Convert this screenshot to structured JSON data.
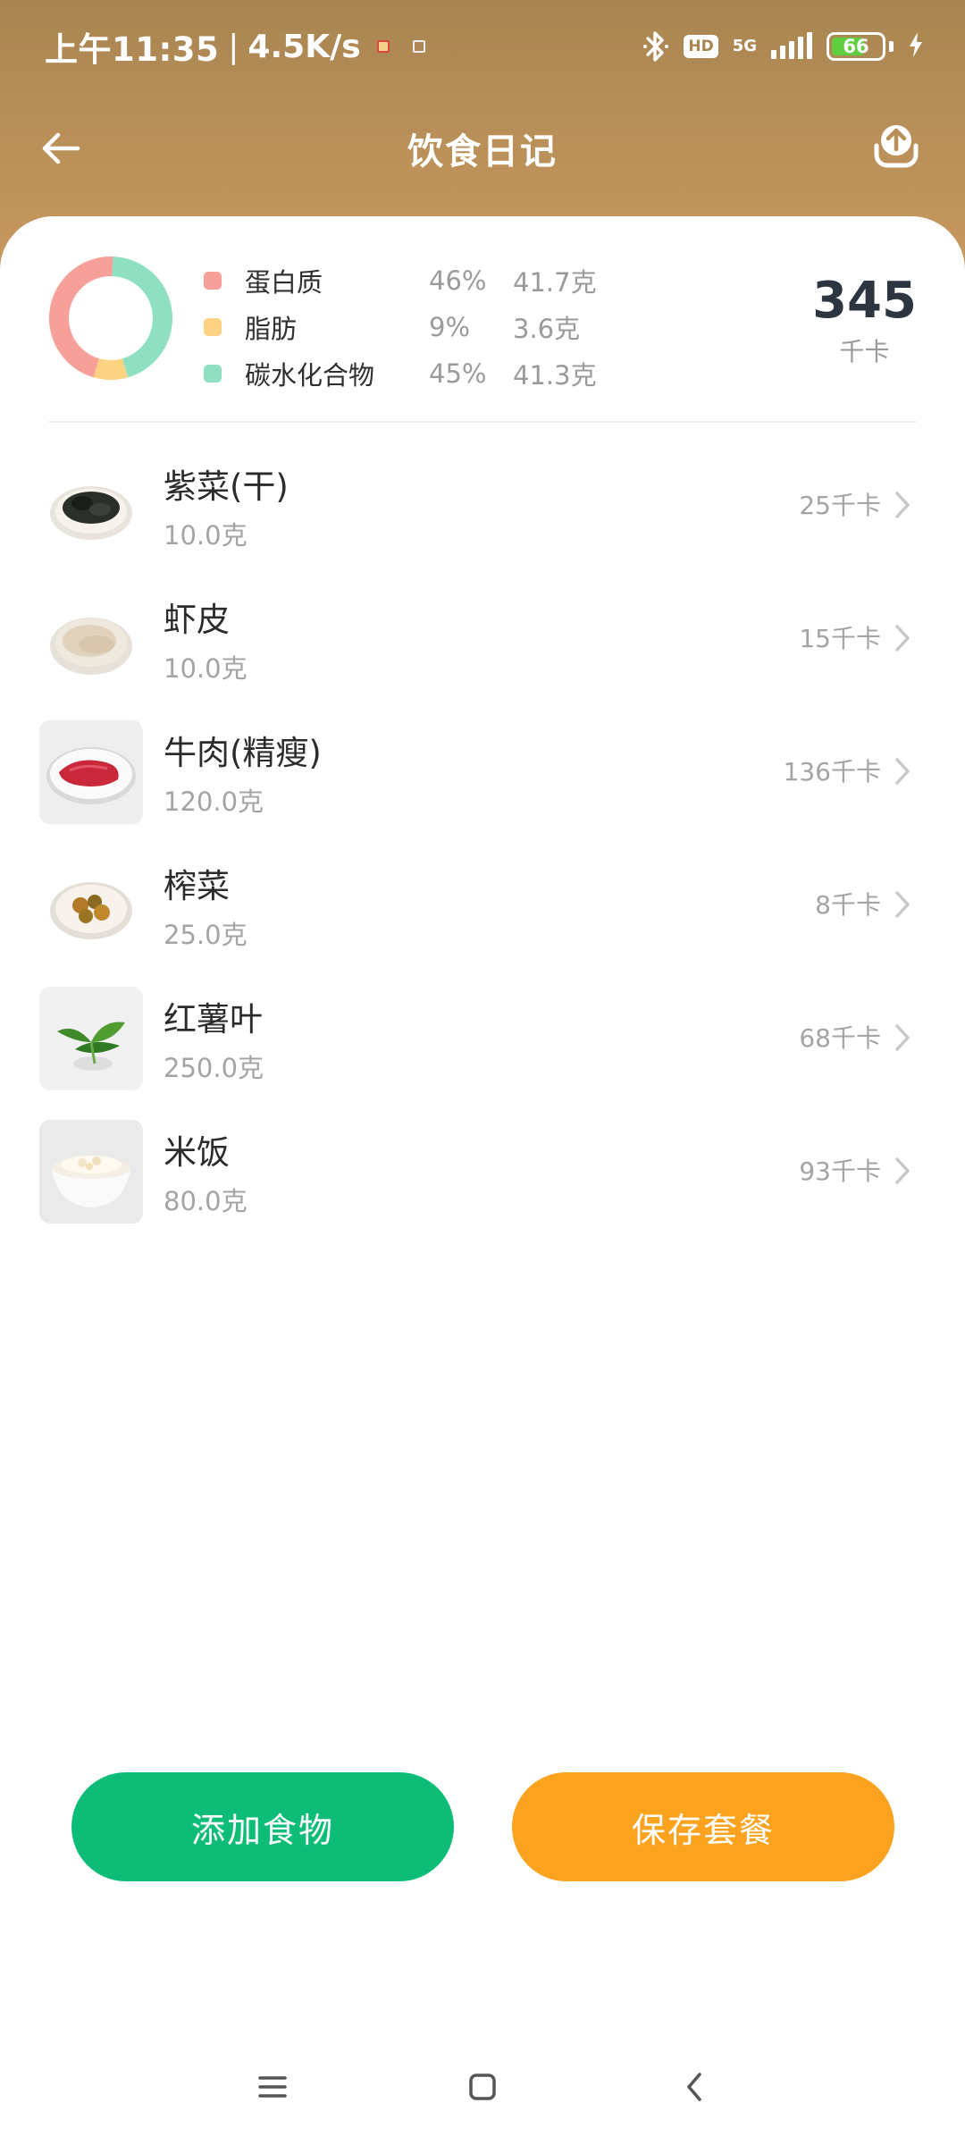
{
  "status_bar": {
    "time": "上午11:35",
    "separator": "|",
    "speed": "4.5K/s",
    "hd": "HD",
    "network": "5G",
    "battery": "66"
  },
  "header": {
    "title": "饮食日记",
    "back_icon": "arrow-left-icon",
    "share_icon": "upload-icon"
  },
  "summary": {
    "macros": [
      {
        "name": "蛋白质",
        "percent": "46%",
        "amount": "41.7克",
        "color": "#f7a09a"
      },
      {
        "name": "脂肪",
        "percent": "9%",
        "amount": "3.6克",
        "color": "#fdd283"
      },
      {
        "name": "碳水化合物",
        "percent": "45%",
        "amount": "41.3克",
        "color": "#8fdfc1"
      }
    ],
    "total_value": "345",
    "total_unit": "千卡"
  },
  "foods": [
    {
      "name": "紫菜(干)",
      "amount": "10.0克",
      "kcal": "25千卡"
    },
    {
      "name": "虾皮",
      "amount": "10.0克",
      "kcal": "15千卡"
    },
    {
      "name": "牛肉(精瘦)",
      "amount": "120.0克",
      "kcal": "136千卡"
    },
    {
      "name": "榨菜",
      "amount": "25.0克",
      "kcal": "8千卡"
    },
    {
      "name": "红薯叶",
      "amount": "250.0克",
      "kcal": "68千卡"
    },
    {
      "name": "米饭",
      "amount": "80.0克",
      "kcal": "93千卡"
    }
  ],
  "actions": {
    "add_label": "添加食物",
    "save_label": "保存套餐",
    "add_color": "#0dbd77",
    "save_color": "#fba31f"
  },
  "system_nav": {
    "menu_icon": "menu-icon",
    "home_icon": "home-square-icon",
    "back_icon": "back-chevron-icon"
  }
}
